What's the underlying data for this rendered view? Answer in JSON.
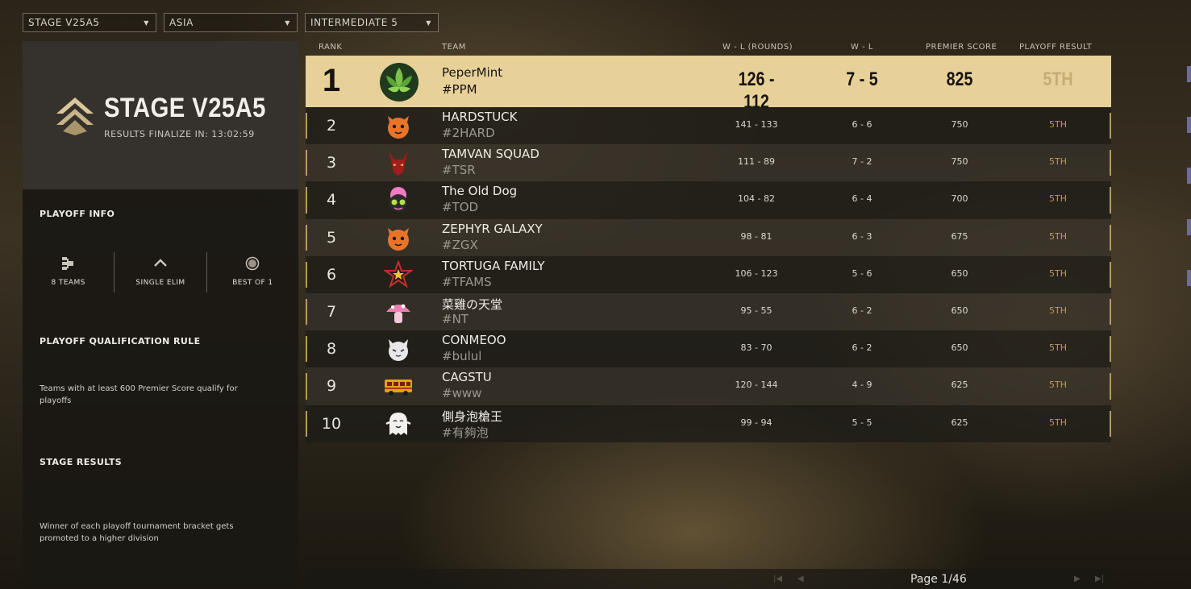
{
  "filters": {
    "stage": "STAGE V25A5",
    "region": "ASIA",
    "division": "INTERMEDIATE 5"
  },
  "sidebar": {
    "stage_title": "STAGE V25A5",
    "finalize": "RESULTS FINALIZE IN: 13:02:59",
    "playoff_info_title": "PLAYOFF INFO",
    "info": [
      {
        "icon": "bracket-icon",
        "label": "8 TEAMS"
      },
      {
        "icon": "chevron-up-icon",
        "label": "SINGLE ELIM"
      },
      {
        "icon": "circle-target-icon",
        "label": "BEST OF 1"
      }
    ],
    "qualification_title": "PLAYOFF QUALIFICATION RULE",
    "qualification_text": "Teams with at least 600 Premier Score qualify for playoffs",
    "results_title": "STAGE RESULTS",
    "results_text": "Winner of each playoff tournament bracket gets promoted to a higher division"
  },
  "table": {
    "headers": {
      "rank": "RANK",
      "team": "TEAM",
      "rounds": "W - L (ROUNDS)",
      "wl": "W - L",
      "score": "PREMIER SCORE",
      "playoff": "PLAYOFF RESULT"
    },
    "rows": [
      {
        "rank": "1",
        "name": "PeperMint",
        "tag": "#PPM",
        "rounds": "126 - 112",
        "wl": "7 - 5",
        "score": "825",
        "playoff": "5TH",
        "avatar": "leaf-avatar"
      },
      {
        "rank": "2",
        "name": "HARDSTUCK",
        "tag": "#2HARD",
        "rounds": "141 - 133",
        "wl": "6 - 6",
        "score": "750",
        "playoff": "5TH",
        "avatar": "orange-cat-avatar"
      },
      {
        "rank": "3",
        "name": "TAMVAN SQUAD",
        "tag": "#TSR",
        "rounds": "111 - 89",
        "wl": "7 - 2",
        "score": "750",
        "playoff": "5TH",
        "avatar": "red-demon-avatar"
      },
      {
        "rank": "4",
        "name": "The Old Dog",
        "tag": "#TOD",
        "rounds": "104 - 82",
        "wl": "6 - 4",
        "score": "700",
        "playoff": "5TH",
        "avatar": "pink-creature-avatar"
      },
      {
        "rank": "5",
        "name": "ZEPHYR GALAXY",
        "tag": "#ZGX",
        "rounds": "98 - 81",
        "wl": "6 - 3",
        "score": "675",
        "playoff": "5TH",
        "avatar": "orange-cat-avatar"
      },
      {
        "rank": "6",
        "name": "TORTUGA FAMILY",
        "tag": "#TFAMS",
        "rounds": "106 - 123",
        "wl": "5 - 6",
        "score": "650",
        "playoff": "5TH",
        "avatar": "star-avatar"
      },
      {
        "rank": "7",
        "name": "菜雞の天堂",
        "tag": "#NT",
        "rounds": "95 - 55",
        "wl": "6 - 2",
        "score": "650",
        "playoff": "5TH",
        "avatar": "mushroom-avatar"
      },
      {
        "rank": "8",
        "name": "CONMEOO",
        "tag": "#bulul",
        "rounds": "83 - 70",
        "wl": "6 - 2",
        "score": "650",
        "playoff": "5TH",
        "avatar": "white-cat-avatar"
      },
      {
        "rank": "9",
        "name": "CAGSTU",
        "tag": "#www",
        "rounds": "120 - 144",
        "wl": "4 - 9",
        "score": "625",
        "playoff": "5TH",
        "avatar": "bus-avatar"
      },
      {
        "rank": "10",
        "name": "側身泡槍王",
        "tag": "#有夠泡",
        "rounds": "99 - 94",
        "wl": "5 - 5",
        "score": "625",
        "playoff": "5TH",
        "avatar": "ghost-avatar"
      }
    ]
  },
  "pagination": {
    "label": "Page 1/46"
  },
  "colors": {
    "highlight_row": "#e7d199",
    "accent": "#b89a5e"
  }
}
